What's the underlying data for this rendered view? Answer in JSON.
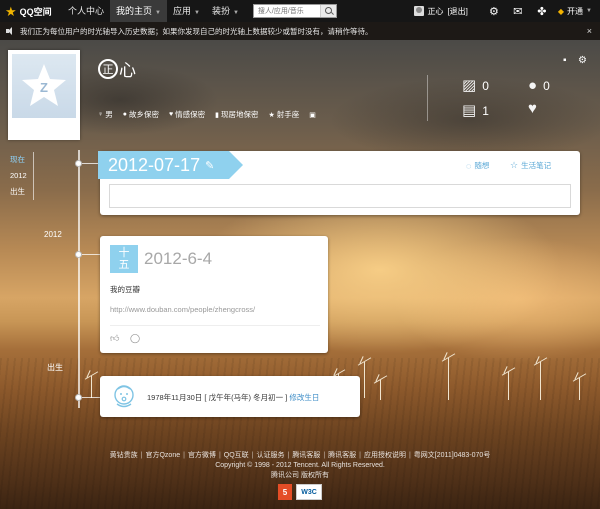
{
  "topbar": {
    "logo_text": "QQ空间",
    "nav": [
      "个人中心",
      "我的主页",
      "应用",
      "装扮"
    ],
    "search_placeholder": "搜人/应用/音乐",
    "user_name": "正心",
    "logout": "[退出]",
    "open_label": "开通"
  },
  "notice": {
    "text": "我们正为每位用户的时光轴导入历史数据；如果你发现自己的时光轴上数据较少或暂时没有，请稍作等待。",
    "close": "×"
  },
  "profile": {
    "name_circle": "正",
    "name_rest": "心",
    "tags": [
      {
        "icon": "♀",
        "label": "男"
      },
      {
        "icon": "●",
        "label": "故乡保密"
      },
      {
        "icon": "♥",
        "label": "情感保密"
      },
      {
        "icon": "▮",
        "label": "现居地保密"
      },
      {
        "icon": "★",
        "label": "射手座"
      },
      {
        "icon": "▣",
        "label": ""
      }
    ],
    "stats": {
      "photos": "0",
      "comments": "0",
      "journals": "1"
    }
  },
  "yearnav": [
    "现在",
    "2012",
    "出生"
  ],
  "timeline": {
    "year_2012": "2012",
    "birth_label": "出生"
  },
  "compose": {
    "date": "2012-07-17",
    "mood_label": "随想",
    "note_label": "生活笔记"
  },
  "post": {
    "cal_top": "十",
    "cal_bottom": "五",
    "date": "2012-6-4",
    "title": "我的豆瓣",
    "link": "http://www.douban.com/people/zhengcross/"
  },
  "birth": {
    "text": "1978年11月30日 [ 戊午年(马年) 冬月初一 ]",
    "edit": "修改生日"
  },
  "footer": {
    "links": [
      "黄钻贵族",
      "官方Qzone",
      "官方微博",
      "QQ互联",
      "认证服务",
      "腾讯客服",
      "腾讯客服",
      "应用授权说明",
      "粤网文[2011]0483-070号"
    ],
    "copyright": "Copyright © 1998 - 2012 Tencent. All Rights Reserved.",
    "company": "腾讯公司 版权所有",
    "html5": "5",
    "w3c": "W3C"
  },
  "colors": {
    "accent": "#8fd1ee",
    "link": "#3d8dc7",
    "topbar": "#161616"
  }
}
